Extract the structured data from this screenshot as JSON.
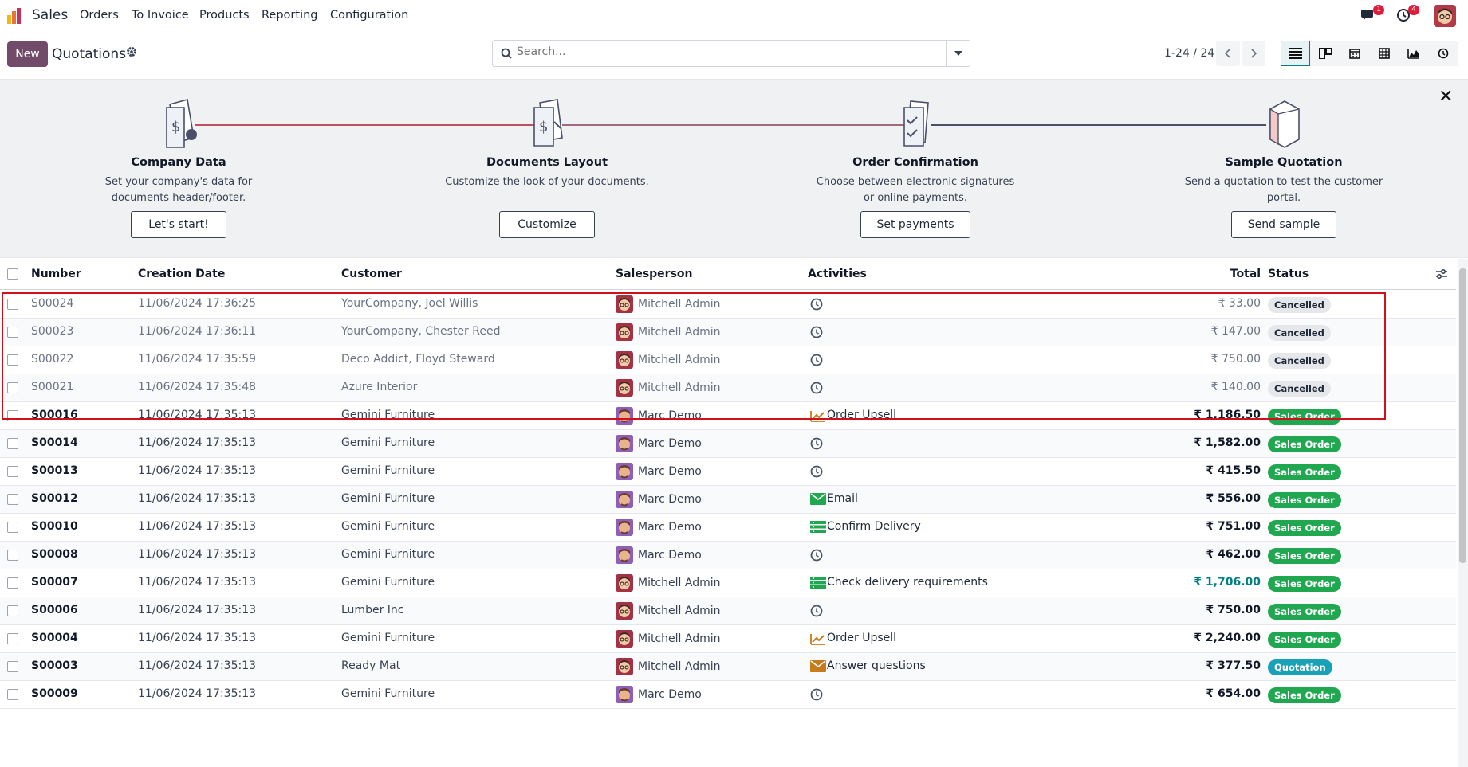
{
  "nav": {
    "app_name": "Sales",
    "menus": [
      "Orders",
      "To Invoice",
      "Products",
      "Reporting",
      "Configuration"
    ],
    "messages_count": "1",
    "activities_count": "4"
  },
  "control": {
    "new_label": "New",
    "title": "Quotations",
    "search_placeholder": "Search...",
    "pager": "1-24 / 24"
  },
  "onboarding": {
    "steps": [
      {
        "title": "Company Data",
        "desc": "Set your company's data for documents header/footer.",
        "button": "Let's start!"
      },
      {
        "title": "Documents Layout",
        "desc": "Customize the look of your documents.",
        "button": "Customize"
      },
      {
        "title": "Order Confirmation",
        "desc": "Choose between electronic signatures or online payments.",
        "button": "Set payments"
      },
      {
        "title": "Sample Quotation",
        "desc": "Send a quotation to test the customer portal.",
        "button": "Send sample"
      }
    ]
  },
  "table": {
    "headers": {
      "number": "Number",
      "date": "Creation Date",
      "customer": "Customer",
      "salesperson": "Salesperson",
      "activities": "Activities",
      "total": "Total",
      "status": "Status"
    },
    "rows": [
      {
        "number": "S00024",
        "date": "11/06/2024 17:36:25",
        "customer": "YourCompany, Joel Willis",
        "salesperson": "Mitchell Admin",
        "activity": "",
        "total": "₹ 33.00",
        "status": "Cancelled"
      },
      {
        "number": "S00023",
        "date": "11/06/2024 17:36:11",
        "customer": "YourCompany, Chester Reed",
        "salesperson": "Mitchell Admin",
        "activity": "",
        "total": "₹ 147.00",
        "status": "Cancelled"
      },
      {
        "number": "S00022",
        "date": "11/06/2024 17:35:59",
        "customer": "Deco Addict, Floyd Steward",
        "salesperson": "Mitchell Admin",
        "activity": "",
        "total": "₹ 750.00",
        "status": "Cancelled"
      },
      {
        "number": "S00021",
        "date": "11/06/2024 17:35:48",
        "customer": "Azure Interior",
        "salesperson": "Mitchell Admin",
        "activity": "",
        "total": "₹ 140.00",
        "status": "Cancelled"
      },
      {
        "number": "S00016",
        "date": "11/06/2024 17:35:13",
        "customer": "Gemini Furniture",
        "salesperson": "Marc Demo",
        "activity": "Order Upsell",
        "total": "₹ 1,186.50",
        "status": "Sales Order"
      },
      {
        "number": "S00014",
        "date": "11/06/2024 17:35:13",
        "customer": "Gemini Furniture",
        "salesperson": "Marc Demo",
        "activity": "",
        "total": "₹ 1,582.00",
        "status": "Sales Order"
      },
      {
        "number": "S00013",
        "date": "11/06/2024 17:35:13",
        "customer": "Gemini Furniture",
        "salesperson": "Marc Demo",
        "activity": "",
        "total": "₹ 415.50",
        "status": "Sales Order"
      },
      {
        "number": "S00012",
        "date": "11/06/2024 17:35:13",
        "customer": "Gemini Furniture",
        "salesperson": "Marc Demo",
        "activity": "Email",
        "total": "₹ 556.00",
        "status": "Sales Order"
      },
      {
        "number": "S00010",
        "date": "11/06/2024 17:35:13",
        "customer": "Gemini Furniture",
        "salesperson": "Marc Demo",
        "activity": "Confirm Delivery",
        "total": "₹ 751.00",
        "status": "Sales Order"
      },
      {
        "number": "S00008",
        "date": "11/06/2024 17:35:13",
        "customer": "Gemini Furniture",
        "salesperson": "Marc Demo",
        "activity": "",
        "total": "₹ 462.00",
        "status": "Sales Order"
      },
      {
        "number": "S00007",
        "date": "11/06/2024 17:35:13",
        "customer": "Gemini Furniture",
        "salesperson": "Mitchell Admin",
        "activity": "Check delivery requirements",
        "total": "₹ 1,706.00",
        "status": "Sales Order"
      },
      {
        "number": "S00006",
        "date": "11/06/2024 17:35:13",
        "customer": "Lumber Inc",
        "salesperson": "Mitchell Admin",
        "activity": "",
        "total": "₹ 750.00",
        "status": "Sales Order"
      },
      {
        "number": "S00004",
        "date": "11/06/2024 17:35:13",
        "customer": "Gemini Furniture",
        "salesperson": "Mitchell Admin",
        "activity": "Order Upsell",
        "total": "₹ 2,240.00",
        "status": "Sales Order"
      },
      {
        "number": "S00003",
        "date": "11/06/2024 17:35:13",
        "customer": "Ready Mat",
        "salesperson": "Mitchell Admin",
        "activity": "Answer questions",
        "total": "₹ 377.50",
        "status": "Quotation"
      },
      {
        "number": "S00009",
        "date": "11/06/2024 17:35:13",
        "customer": "Gemini Furniture",
        "salesperson": "Marc Demo",
        "activity": "",
        "total": "₹ 654.00",
        "status": "Sales Order"
      }
    ]
  },
  "colors": {
    "brand": "#714b67",
    "accent": "#017e84",
    "highlight": "#d0111b"
  }
}
